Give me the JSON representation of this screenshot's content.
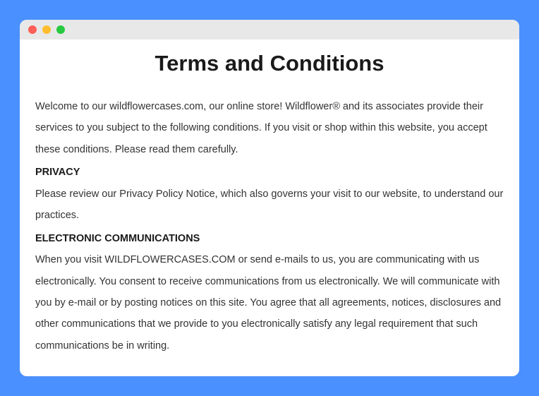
{
  "titlebar": {
    "controls": [
      "close",
      "minimize",
      "maximize"
    ]
  },
  "page": {
    "title": "Terms and Conditions",
    "intro": "Welcome to our wildflowercases.com, our online store! Wildflower® and its associates provide their services to you subject to the following conditions. If you visit or shop within this website, you accept these conditions. Please read them carefully.",
    "sections": [
      {
        "heading": "PRIVACY",
        "body": "Please review our Privacy Policy Notice, which also governs your visit to our website, to understand our practices."
      },
      {
        "heading": "ELECTRONIC COMMUNICATIONS",
        "body": "When you visit WILDFLOWERCASES.COM or send e-mails to us, you are communicating with us electronically. You consent to receive communications from us electronically. We will communicate with you by e-mail or by posting notices on this site. You agree that all agreements, notices, disclosures and other communications that we provide to you electronically satisfy any legal requirement that such communications be in writing."
      }
    ]
  }
}
